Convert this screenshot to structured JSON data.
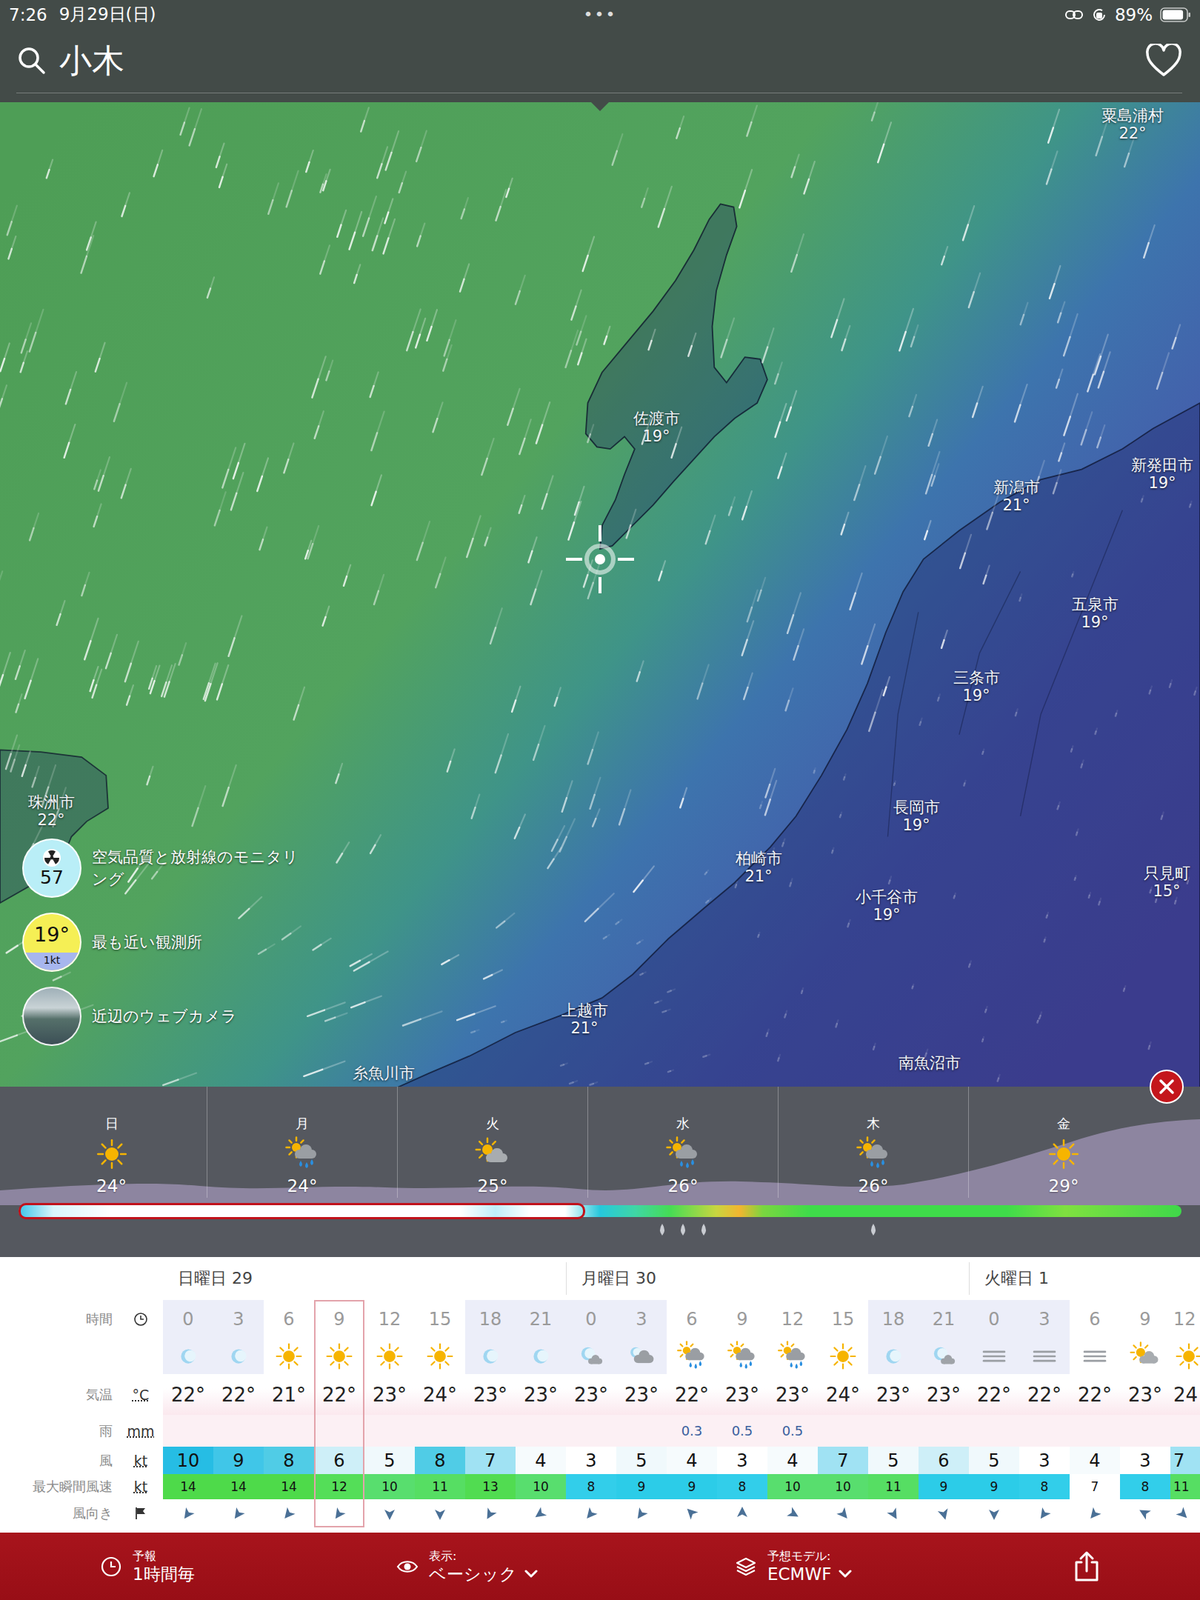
{
  "status_bar": {
    "time": "7:26",
    "date": "9月29日(日)",
    "dots": "•••",
    "battery": "89%",
    "battery_level": 0.89
  },
  "search": {
    "value": "小木"
  },
  "map": {
    "labels": [
      {
        "name": "粟島浦村",
        "temp": "22°"
      },
      {
        "name": "佐渡市",
        "temp": "19°"
      },
      {
        "name": "新潟市",
        "temp": "21°"
      },
      {
        "name": "新発田市",
        "temp": "19°"
      },
      {
        "name": "五泉市",
        "temp": "19°"
      },
      {
        "name": "三条市",
        "temp": "19°"
      },
      {
        "name": "長岡市",
        "temp": "19°"
      },
      {
        "name": "柏崎市",
        "temp": "21°"
      },
      {
        "name": "小千谷市",
        "temp": "19°"
      },
      {
        "name": "只見町",
        "temp": "15°"
      },
      {
        "name": "珠洲市",
        "temp": "22°"
      },
      {
        "name": "上越市",
        "temp": "21°"
      },
      {
        "name": "糸魚川市"
      },
      {
        "name": "南魚沼市"
      }
    ]
  },
  "overlays": [
    {
      "kind": "air",
      "badge": "57",
      "label": "空気品質と放射線のモニタリング"
    },
    {
      "kind": "station",
      "badge": "19°",
      "sub": "1kt",
      "label": "最も近い観測所"
    },
    {
      "kind": "webcam",
      "label": "近辺のウェブカメラ"
    }
  ],
  "daily": [
    {
      "day": "日",
      "temp": "24°",
      "kind": "sun",
      "drops": 0
    },
    {
      "day": "月",
      "temp": "24°",
      "kind": "sun-rain",
      "drops": 0
    },
    {
      "day": "火",
      "temp": "25°",
      "kind": "sun-cloud",
      "drops": 0
    },
    {
      "day": "水",
      "temp": "26°",
      "kind": "sun-rain",
      "drops": 3
    },
    {
      "day": "木",
      "temp": "26°",
      "kind": "sun-rain",
      "drops": 1
    },
    {
      "day": "金",
      "temp": "29°",
      "kind": "sun",
      "drops": 0
    }
  ],
  "timeline": {
    "level": 0.487
  },
  "table": {
    "days": [
      "日曜日 29",
      "月曜日 30",
      "火曜日 1"
    ],
    "row_labels": {
      "hour": {
        "label": "時間"
      },
      "temp": {
        "label": "気温",
        "unit": "°C"
      },
      "rain": {
        "label": "雨",
        "unit": "mm"
      },
      "wind": {
        "label": "風",
        "unit": "kt"
      },
      "gust": {
        "label": "最大瞬間風速",
        "unit": "kt"
      },
      "dir": {
        "label": "風向き"
      }
    },
    "columns": [
      {
        "hour": "0",
        "kind": "moon",
        "night": true,
        "temp": "22°",
        "wind": "10",
        "gust": "14",
        "dir": 215,
        "selected": false
      },
      {
        "hour": "3",
        "kind": "moon",
        "night": true,
        "temp": "22°",
        "wind": "9",
        "gust": "14",
        "dir": 215,
        "selected": false
      },
      {
        "hour": "6",
        "kind": "sun",
        "night": false,
        "temp": "21°",
        "wind": "8",
        "gust": "14",
        "dir": 220,
        "selected": false
      },
      {
        "hour": "9",
        "kind": "sun",
        "night": false,
        "temp": "22°",
        "wind": "6",
        "gust": "12",
        "dir": 215,
        "selected": true
      },
      {
        "hour": "12",
        "kind": "sun",
        "night": false,
        "temp": "23°",
        "wind": "5",
        "gust": "10",
        "dir": 180,
        "selected": false
      },
      {
        "hour": "15",
        "kind": "sun",
        "night": false,
        "temp": "24°",
        "wind": "8",
        "gust": "11",
        "dir": 180,
        "selected": false
      },
      {
        "hour": "18",
        "kind": "moon",
        "night": true,
        "temp": "23°",
        "wind": "7",
        "gust": "13",
        "dir": 210,
        "selected": false
      },
      {
        "hour": "21",
        "kind": "moon",
        "night": true,
        "temp": "23°",
        "wind": "4",
        "gust": "10",
        "dir": 235,
        "selected": false
      },
      {
        "hour": "0",
        "kind": "moon-cloud",
        "night": true,
        "temp": "23°",
        "wind": "3",
        "gust": "8",
        "dir": 220,
        "selected": false
      },
      {
        "hour": "3",
        "kind": "cloud-moon",
        "night": true,
        "temp": "23°",
        "wind": "5",
        "gust": "9",
        "dir": 215,
        "selected": false
      },
      {
        "hour": "6",
        "kind": "sun-rain",
        "night": false,
        "temp": "22°",
        "rain": "0.3",
        "wind": "4",
        "gust": "9",
        "dir": 315,
        "selected": false
      },
      {
        "hour": "9",
        "kind": "sun-rain",
        "night": false,
        "temp": "23°",
        "rain": "0.5",
        "wind": "3",
        "gust": "8",
        "dir": 0,
        "selected": false
      },
      {
        "hour": "12",
        "kind": "sun-rain",
        "night": false,
        "temp": "23°",
        "rain": "0.5",
        "wind": "4",
        "gust": "10",
        "dir": 120,
        "selected": false
      },
      {
        "hour": "15",
        "kind": "sun",
        "night": false,
        "temp": "24°",
        "wind": "7",
        "gust": "10",
        "dir": 140,
        "selected": false
      },
      {
        "hour": "18",
        "kind": "moon",
        "night": true,
        "temp": "23°",
        "wind": "5",
        "gust": "11",
        "dir": 150,
        "selected": false
      },
      {
        "hour": "21",
        "kind": "moon-cloud",
        "night": true,
        "temp": "23°",
        "wind": "6",
        "gust": "9",
        "dir": 165,
        "selected": false
      },
      {
        "hour": "0",
        "kind": "fog",
        "night": true,
        "temp": "22°",
        "wind": "5",
        "gust": "9",
        "dir": 180,
        "selected": false
      },
      {
        "hour": "3",
        "kind": "fog",
        "night": true,
        "temp": "22°",
        "wind": "3",
        "gust": "8",
        "dir": 215,
        "selected": false
      },
      {
        "hour": "6",
        "kind": "fog",
        "night": false,
        "temp": "22°",
        "wind": "4",
        "gust": "7",
        "dir": 220,
        "selected": false
      },
      {
        "hour": "9",
        "kind": "sun-cloud",
        "night": false,
        "temp": "23°",
        "wind": "3",
        "gust": "8",
        "dir": 300,
        "selected": false
      },
      {
        "hour": "12",
        "kind": "sun",
        "night": false,
        "temp": "24",
        "wind": "7",
        "gust": "11",
        "dir": 135,
        "selected": false
      }
    ]
  },
  "bottom_bar": [
    {
      "caption": "予報",
      "value": "1時間毎",
      "dropdown": false
    },
    {
      "caption": "表示:",
      "value": "ベーシック",
      "dropdown": true
    },
    {
      "caption": "予想モデル:",
      "value": "ECMWF",
      "dropdown": true
    }
  ]
}
